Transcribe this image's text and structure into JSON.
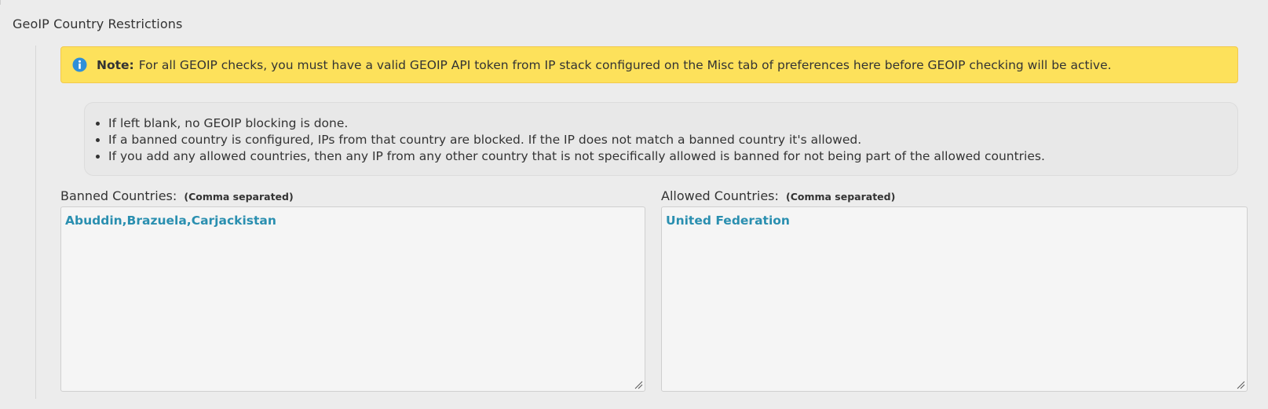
{
  "section": {
    "title": "GeoIP Country Restrictions"
  },
  "note": {
    "icon": "info-icon",
    "label": "Note:",
    "text": "For all GEOIP checks, you must have a valid GEOIP API token from IP stack configured on the Misc tab of preferences here before GEOIP checking will be active.",
    "background_color": "#fde15b",
    "icon_color": "#2f8fd8"
  },
  "rules": [
    "If left blank, no GEOIP blocking is done.",
    "If a banned country is configured, IPs from that country are blocked. If the IP does not match a banned country it's allowed.",
    "If you add any allowed countries, then any IP from any other country that is not specifically allowed is banned for not being part of the allowed countries."
  ],
  "banned": {
    "label": "Banned Countries:",
    "hint": "(Comma separated)",
    "value": "Abuddin,Brazuela,Carjackistan"
  },
  "allowed": {
    "label": "Allowed Countries:",
    "hint": "(Comma separated)",
    "value": "United Federation"
  },
  "colors": {
    "input_text": "#2a8fb0",
    "page_background": "#ececec"
  }
}
